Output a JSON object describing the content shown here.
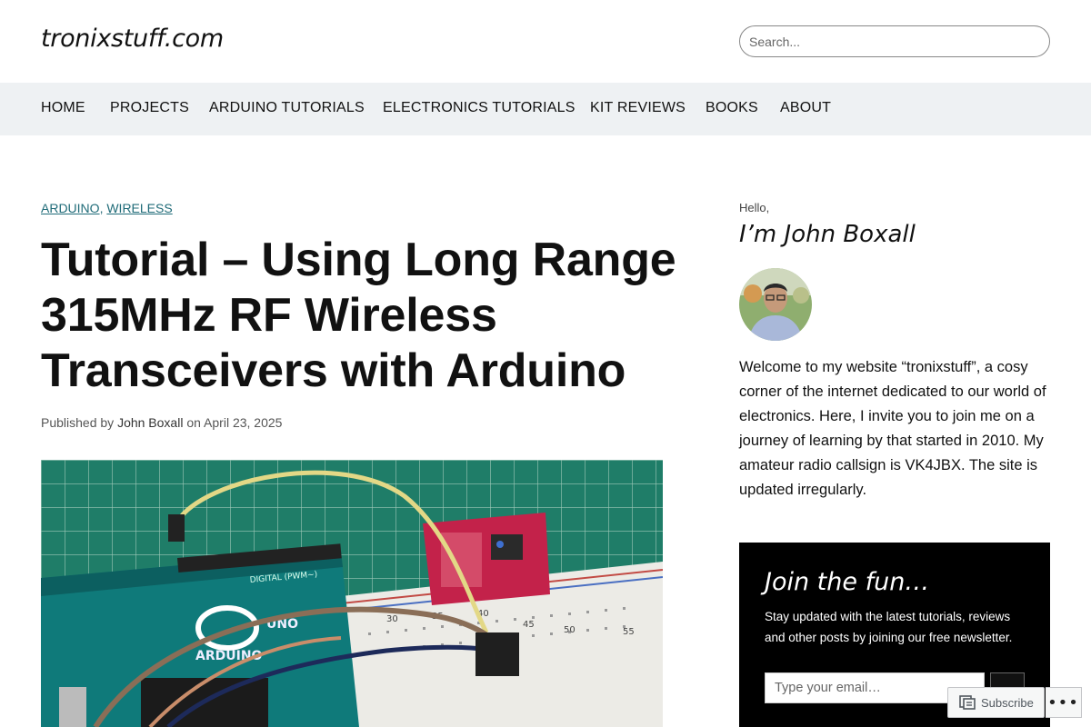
{
  "header": {
    "site_title": "tronixstuff.com",
    "search_placeholder": "Search..."
  },
  "nav": {
    "items": [
      {
        "label": "HOME"
      },
      {
        "label": "PROJECTS"
      },
      {
        "label": "ARDUINO TUTORIALS"
      },
      {
        "label": "ELECTRONICS TUTORIALS"
      },
      {
        "label": "KIT REVIEWS"
      },
      {
        "label": "BOOKS"
      },
      {
        "label": "ABOUT"
      }
    ]
  },
  "post": {
    "categories": [
      "ARDUINO",
      "WIRELESS"
    ],
    "category_sep": ",",
    "title": "Tutorial – Using Long Range 315MHz RF Wireless Transceivers with Arduino",
    "meta_prefix": "Published by",
    "author": "John Boxall",
    "meta_on": "on",
    "date": "April 23, 2025",
    "image_labels": {
      "digital": "DIGITAL (PWM~)",
      "uno": "UNO",
      "arduino": "ARDUINO",
      "bb_30": "30",
      "bb_35": "35",
      "bb_40": "40",
      "bb_45": "45",
      "bb_50": "50",
      "bb_55": "55"
    }
  },
  "sidebar": {
    "hello": "Hello,",
    "name": "I’m John Boxall",
    "bio": "Welcome to my website “tronixstuff”, a cosy corner of the internet dedicated to our world of electronics. Here, I invite you to join me on a journey of learning by that started in 2010. My amateur radio callsign is VK4JBX. The site is updated irregularly.",
    "join": {
      "title": "Join the fun…",
      "text": "Stay updated with the latest tutorials, reviews and other posts by joining our free newsletter.",
      "email_placeholder": "Type your email…"
    }
  },
  "floating": {
    "subscribe_label": "Subscribe",
    "more_label": "•••"
  },
  "colors": {
    "nav_bg": "#eef1f3",
    "category_link": "#1f6b78",
    "join_bg": "#000000"
  }
}
